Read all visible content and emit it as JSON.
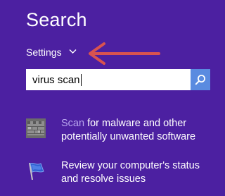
{
  "search": {
    "title": "Search",
    "scope_label": "Settings",
    "query": "virus scan"
  },
  "results": [
    {
      "highlight": "Scan",
      "rest_line1": " for malware and other",
      "line2": "potentially unwanted software",
      "icon": "defender-castle-wall-icon"
    },
    {
      "line1": "Review your computer's status",
      "line2": "and resolve issues",
      "icon": "action-center-flag-icon"
    }
  ],
  "colors": {
    "background": "#4c20a1",
    "search_button": "#5a8be0",
    "highlight": "#b9a6ef",
    "annotation_arrow": "#d9534f"
  }
}
